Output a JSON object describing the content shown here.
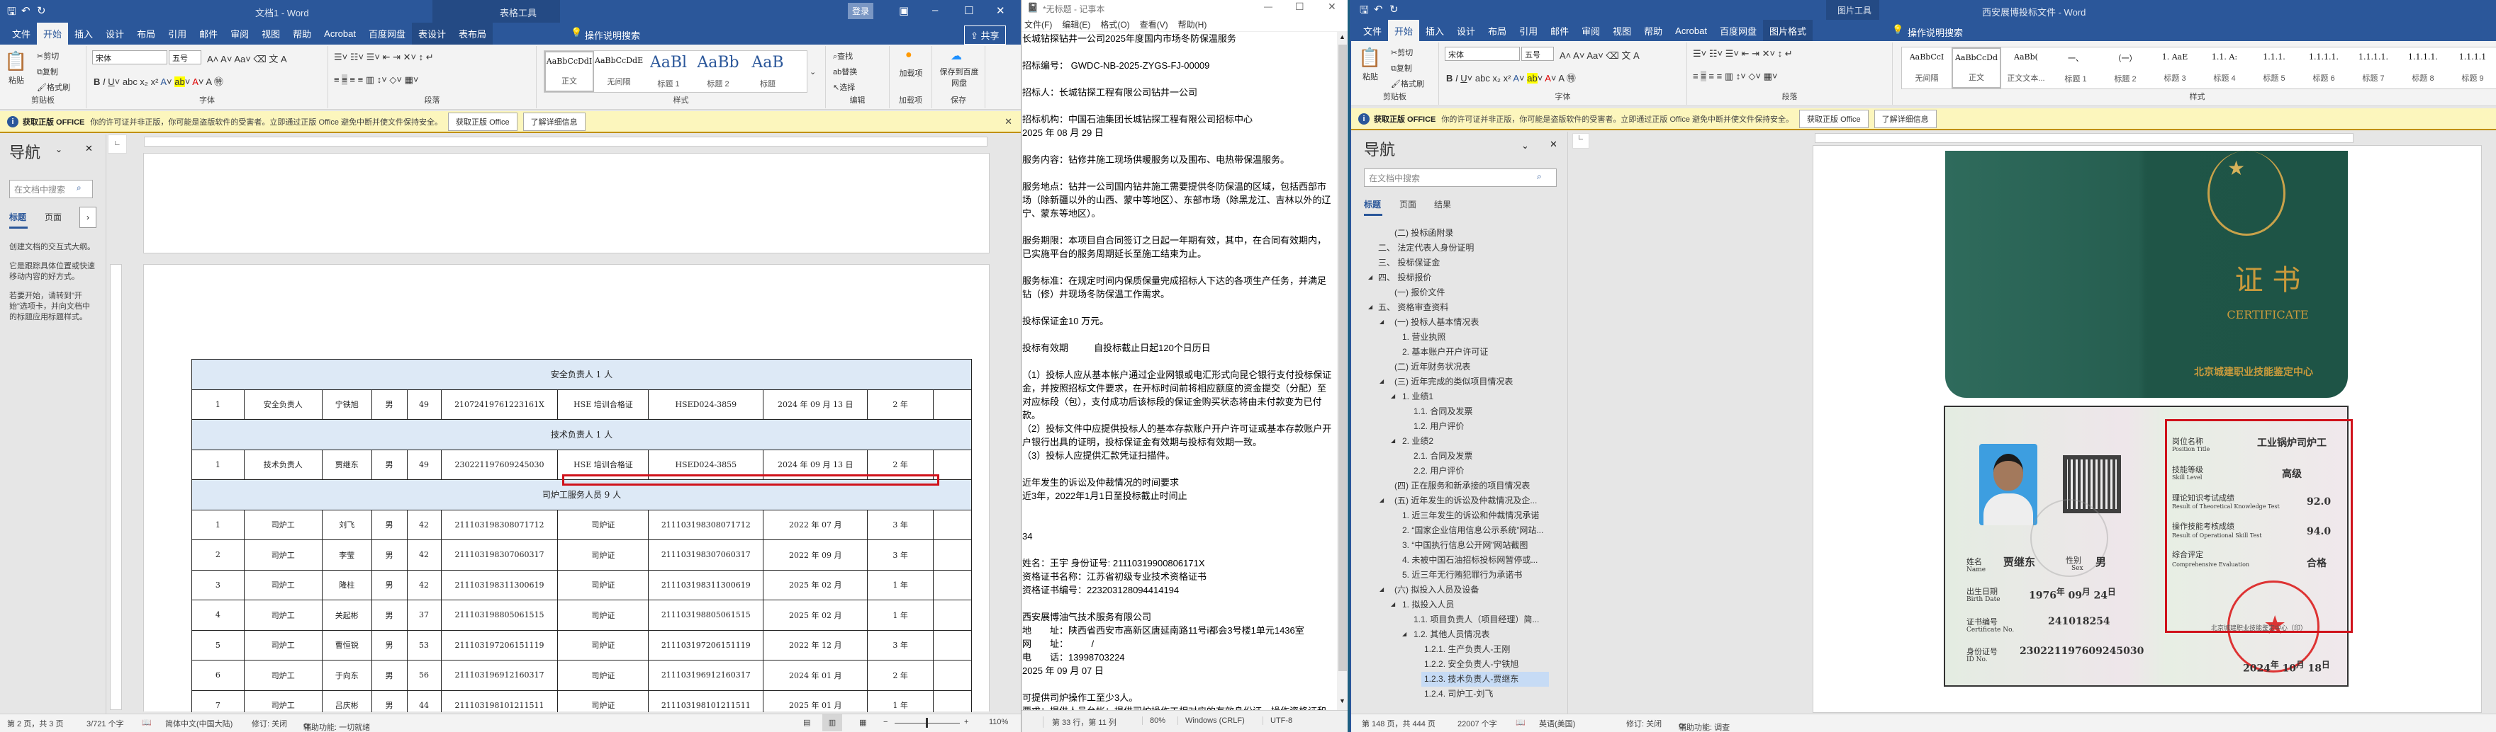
{
  "left_word": {
    "title": "文档1 - Word",
    "context_tool": "表格工具",
    "sign_in": "登录",
    "share": "共享",
    "tabs": [
      "文件",
      "开始",
      "插入",
      "设计",
      "布局",
      "引用",
      "邮件",
      "审阅",
      "视图",
      "帮助",
      "Acrobat",
      "百度网盘",
      "表设计",
      "表布局"
    ],
    "tell_me": "操作说明搜索",
    "ribbon": {
      "clipboard": {
        "label": "剪贴板",
        "paste": "粘贴",
        "cut": "剪切",
        "copy": "复制",
        "format_painter": "格式刷"
      },
      "font": {
        "label": "字体",
        "font_name": "宋体",
        "font_size": "五号"
      },
      "paragraph": {
        "label": "段落"
      },
      "styles": {
        "label": "样式",
        "items": [
          {
            "preview": "AaBbCcDdI",
            "name": "正文"
          },
          {
            "preview": "AaBbCcDdE",
            "name": "无间隔"
          },
          {
            "preview": "AaBl",
            "name": "标题 1"
          },
          {
            "preview": "AaBb",
            "name": "标题 2"
          },
          {
            "preview": "AaB",
            "name": "标题"
          }
        ]
      },
      "editing": {
        "label": "编辑",
        "find": "查找",
        "replace": "替换",
        "select": "选择"
      },
      "addins": {
        "label": "加载项",
        "button": "加载项"
      },
      "save": {
        "label": "保存",
        "button": "保存到百度网盘"
      }
    },
    "infobar": {
      "title": "获取正版 OFFICE",
      "message": "你的许可证并非正版，你可能是盗版软件的受害者。立即通过正版 Office 避免中断并使文件保持安全。",
      "btn_get": "获取正版 Office",
      "btn_learn": "了解详细信息"
    },
    "nav": {
      "title": "导航",
      "search_placeholder": "在文档中搜索",
      "tabs": [
        "标题",
        "页面"
      ],
      "hint": [
        "创建文档的交互式大纲。",
        "它是跟踪具体位置或快速移动内容的好方式。",
        "若要开始，请转到\"开始\"选项卡，并向文档中的标题应用标题样式。"
      ]
    },
    "table": {
      "sections": [
        {
          "title": "安全负责人 1 人",
          "rows": [
            [
              "1",
              "安全负责人",
              "宁铁旭",
              "男",
              "49",
              "21072419761223161X",
              "HSE 培训合格证",
              "HSED024-3859",
              "2024 年 09 月 13 日",
              "2 年",
              ""
            ]
          ]
        },
        {
          "title": "技术负责人 1 人",
          "rows": [
            [
              "1",
              "技术负责人",
              "贾继东",
              "男",
              "49",
              "230221197609245030",
              "HSE 培训合格证",
              "HSED024-3855",
              "2024 年 09 月 13 日",
              "2 年",
              ""
            ]
          ]
        },
        {
          "title": "司炉工服务人员 9 人",
          "rows": [
            [
              "1",
              "司炉工",
              "刘飞",
              "男",
              "42",
              "211103198308071712",
              "司炉证",
              "211103198308071712",
              "2022 年 07 月",
              "3 年",
              ""
            ],
            [
              "2",
              "司炉工",
              "李莹",
              "男",
              "42",
              "211103198307060317",
              "司炉证",
              "211103198307060317",
              "2022 年 09 月",
              "3 年",
              ""
            ],
            [
              "3",
              "司炉工",
              "隆柱",
              "男",
              "42",
              "211103198311300619",
              "司炉证",
              "211103198311300619",
              "2025 年 02 月",
              "1 年",
              ""
            ],
            [
              "4",
              "司炉工",
              "关起彬",
              "男",
              "37",
              "211103198805061515",
              "司炉证",
              "211103198805061515",
              "2025 年 02 月",
              "1 年",
              ""
            ],
            [
              "5",
              "司炉工",
              "曹恒锐",
              "男",
              "53",
              "211103197206151119",
              "司炉证",
              "211103197206151119",
              "2022 年 12 月",
              "3 年",
              ""
            ],
            [
              "6",
              "司炉工",
              "于向东",
              "男",
              "56",
              "211103196912160317",
              "司炉证",
              "211103196912160317",
              "2024 年 01 月",
              "2 年",
              ""
            ],
            [
              "7",
              "司炉工",
              "吕庆彬",
              "男",
              "44",
              "211103198101211511",
              "司炉证",
              "211103198101211511",
              "2025 年 01 月",
              "1 年",
              ""
            ]
          ]
        }
      ]
    },
    "status": {
      "page": "第 2 页，共 3 页",
      "words": "3/721 个字",
      "language": "简体中文(中国大陆)",
      "track": "修订: 关闭",
      "accessibility": "辅助功能: 一切就绪",
      "zoom": "110%"
    }
  },
  "notepad": {
    "title": "*无标题 - 记事本",
    "menu": [
      "文件(F)",
      "编辑(E)",
      "格式(O)",
      "查看(V)",
      "帮助(H)"
    ],
    "lines": [
      "长城钻探钻井一公司2025年度国内市场冬防保温服务",
      "",
      "招标编号： GWDC-NB-2025-ZYGS-FJ-00009",
      "",
      "招标人：长城钻探工程有限公司钻井一公司",
      "",
      "招标机构：中国石油集团长城钻探工程有限公司招标中心",
      "2025 年 08 月 29 日",
      "",
      "服务内容：钻修井施工现场供暖服务以及围布、电热带保温服务。",
      "",
      "服务地点：钻井一公司国内钻井施工需要提供冬防保温的区域，包括西部市场（除新疆以外的山西、蒙中等地区）、东部市场（除黑龙江、吉林以外的辽宁、蒙东等地区）。",
      "",
      "服务期限：本项目自合同签订之日起一年期有效，其中，在合同有效期内，已实施平台的服务周期延长至施工结束为止。",
      "",
      "服务标准：在规定时间内保质保量完成招标人下达的各项生产任务，并满足钻（修）井现场冬防保温工作需求。",
      "",
      "投标保证金10 万元。",
      "",
      "投标有效期          自投标截止日起120个日历日",
      "",
      "（1）投标人应从基本帐户通过企业网银或电汇形式向昆仑银行支付投标保证金，并按照招标文件要求，在开标时间前将相应额度的资金提交（分配）至对应标段（包），支付成功后该标段的保证金购买状态将由未付款变为已付款。",
      "（2）投标文件中应提供投标人的基本存款账户开户许可证或基本存款账户开户银行出具的证明，投标保证金有效期与投标有效期一致。",
      "（3）投标人应提供汇款凭证扫描件。",
      "",
      "近年发生的诉讼及仲裁情况的时间要求",
      "近3年，2022年1月1日至投标截止时间止",
      "",
      "",
      "34",
      "",
      "姓名：王宇 身份证号: 21110319900806171X",
      "资格证书名称：江苏省初级专业技术资格证书",
      "资格证书编号：223203128094414194",
      "",
      "西安展博油气技术服务有限公司",
      "地　　址：陕西省西安市高新区唐延南路11号i都会3号楼1单元1436室",
      "网　　址：　　　/",
      "电　　话：13998703224",
      "2025 年 09 月 07 日",
      "",
      "可提供司炉操作工至少3人。",
      "要求：提供人员台帐；提供司炉操作工相对应的有效身份证、操作资格证和劳动合同原件扫描件；同时须提供司炉操作证网上查询截图。"
    ],
    "status": {
      "position": "第 33 行，第 11 列",
      "zoom": "80%",
      "line_ending": "Windows (CRLF)",
      "encoding": "UTF-8"
    }
  },
  "right_word": {
    "title": "西安展博投标文件 - Word",
    "context_tool": "图片工具",
    "tabs": [
      "文件",
      "开始",
      "插入",
      "设计",
      "布局",
      "引用",
      "邮件",
      "审阅",
      "视图",
      "帮助",
      "Acrobat",
      "百度网盘",
      "图片格式"
    ],
    "tell_me": "操作说明搜索",
    "ribbon": {
      "clipboard": {
        "label": "剪贴板",
        "paste": "粘贴",
        "cut": "剪切",
        "copy": "复制",
        "format_painter": "格式刷"
      },
      "font": {
        "label": "字体",
        "font_name": "宋体",
        "font_size": "五号"
      },
      "paragraph": {
        "label": "段落"
      },
      "styles": {
        "label": "样式",
        "items": [
          {
            "preview": "AaBbCcI",
            "name": "无间隔"
          },
          {
            "preview": "AaBbCcDd",
            "name": "正文"
          },
          {
            "preview": "AaBb(",
            "name": "正文文本..."
          },
          {
            "preview": "一、",
            "name": "标题 1"
          },
          {
            "preview": "（一）",
            "name": "标题 2"
          },
          {
            "preview": "1. AaE",
            "name": "标题 3"
          },
          {
            "preview": "1.1. A:",
            "name": "标题 4"
          },
          {
            "preview": "1.1.1.",
            "name": "标题 5"
          },
          {
            "preview": "1.1.1.1.",
            "name": "标题 6"
          },
          {
            "preview": "1.1.1.1.",
            "name": "标题 7"
          },
          {
            "preview": "1.1.1.1.",
            "name": "标题 8"
          },
          {
            "preview": "1.1.1.1",
            "name": "标题 9"
          }
        ]
      }
    },
    "infobar": {
      "title": "获取正版 OFFICE",
      "message": "你的许可证并非正版，你可能是盗版软件的受害者。立即通过正版 Office 避免中断并使文件保持安全。",
      "btn_get": "获取正版 Office",
      "btn_learn": "了解详细信息"
    },
    "nav": {
      "title": "导航",
      "search_placeholder": "在文档中搜索",
      "tabs": [
        "标题",
        "页面",
        "结果"
      ],
      "items": [
        {
          "text": "(二)  投标函附录",
          "level": 2
        },
        {
          "text": "二、  法定代表人身份证明",
          "level": 1
        },
        {
          "text": "三、  投标保证金",
          "level": 1
        },
        {
          "text": "四、  投标报价",
          "level": 1,
          "expanded": true
        },
        {
          "text": "(一)  报价文件",
          "level": 2
        },
        {
          "text": "五、  资格审查资料",
          "level": 1,
          "expanded": true
        },
        {
          "text": "(一)  投标人基本情况表",
          "level": 2,
          "expanded": true
        },
        {
          "text": "1. 营业执照",
          "level": 3
        },
        {
          "text": "2. 基本账户开户许可证",
          "level": 3
        },
        {
          "text": "(二)  近年财务状况表",
          "level": 2
        },
        {
          "text": "(三)  近年完成的类似项目情况表",
          "level": 2,
          "expanded": true
        },
        {
          "text": "1. 业绩1",
          "level": 3,
          "expanded": true
        },
        {
          "text": "1.1. 合同及发票",
          "level": 4
        },
        {
          "text": "1.2. 用户评价",
          "level": 4
        },
        {
          "text": "2. 业绩2",
          "level": 3,
          "expanded": true
        },
        {
          "text": "2.1. 合同及发票",
          "level": 4
        },
        {
          "text": "2.2. 用户评价",
          "level": 4
        },
        {
          "text": "(四)  正在服务和新承接的项目情况表",
          "level": 2
        },
        {
          "text": "(五)  近年发生的诉讼及仲裁情况及企...",
          "level": 2,
          "expanded": true
        },
        {
          "text": "1. 近三年发生的诉讼和仲裁情况承诺",
          "level": 3
        },
        {
          "text": "2. “国家企业信用信息公示系统”网站...",
          "level": 3
        },
        {
          "text": "3. “中国执行信息公开网”网站截图",
          "level": 3
        },
        {
          "text": "4. 未被中国石油招标投标网暂停或...",
          "level": 3
        },
        {
          "text": "5. 近三年无行贿犯罪行为承诺书",
          "level": 3
        },
        {
          "text": "(六)  拟投入人员及设备",
          "level": 2,
          "expanded": true
        },
        {
          "text": "1. 拟投入人员",
          "level": 3,
          "expanded": true
        },
        {
          "text": "1.1. 项目负责人（项目经理）简...",
          "level": 4
        },
        {
          "text": "1.2. 其他人员情况表",
          "level": 4,
          "expanded": true
        },
        {
          "text": "1.2.1. 生产负责人-王刚",
          "level": 5
        },
        {
          "text": "1.2.2. 安全负责人-宁铁旭",
          "level": 5
        },
        {
          "text": "1.2.3. 技术负责人-贾继东",
          "level": 5,
          "selected": true
        },
        {
          "text": "1.2.4. 司炉工-刘飞",
          "level": 5
        }
      ]
    },
    "certificate": {
      "cover_title": "证 书",
      "cover_en": "CERTIFICATE",
      "cover_issuer": "北京城建职业技能鉴定中心",
      "name_label": "姓名",
      "name_en": "Name",
      "name": "贾继东",
      "sex_label": "性别",
      "sex_en": "Sex",
      "sex": "男",
      "birth_label": "出生日期",
      "birth_en": "Birth Date",
      "birth_year": "1976",
      "birth_month": "09",
      "birth_day": "24",
      "year_unit": "年",
      "month_unit": "月",
      "day_unit": "日",
      "cert_no_label": "证书编号",
      "cert_no_en": "Certificate No.",
      "cert_no": "241018254",
      "id_label": "身份证号",
      "id_en": "ID No.",
      "id_no": "230221197609245030",
      "position_label": "岗位名称",
      "position_en": "Position Title",
      "position": "工业锅炉司炉工",
      "skill_label": "技能等级",
      "skill_en": "Skill Level",
      "skill": "高级",
      "theory_label": "理论知识考试成绩",
      "theory_en": "Result of Theoretical Knowledge Test",
      "theory": "92.0",
      "operation_label": "操作技能考核成绩",
      "operation_en": "Result of Operational Skill Test",
      "operation": "94.0",
      "eval_label": "综合评定",
      "eval_en": "Comprehensive Evaluation",
      "eval": "合格",
      "seal_text": "北京城建职业技能鉴定中心",
      "issuer_print": "北京城建职业技能鉴定中心（印）",
      "issue_year": "2024",
      "issue_month": "10",
      "issue_day": "18"
    },
    "status": {
      "page": "第 148 页，共 444 页",
      "words": "22007 个字",
      "language": "英语(美国)",
      "track": "修订: 关闭",
      "accessibility": "辅助功能: 调查"
    }
  },
  "colors": {
    "word_blue": "#2b579a",
    "highlight_red": "#d0121b",
    "section_blue": "#dde9f6"
  }
}
